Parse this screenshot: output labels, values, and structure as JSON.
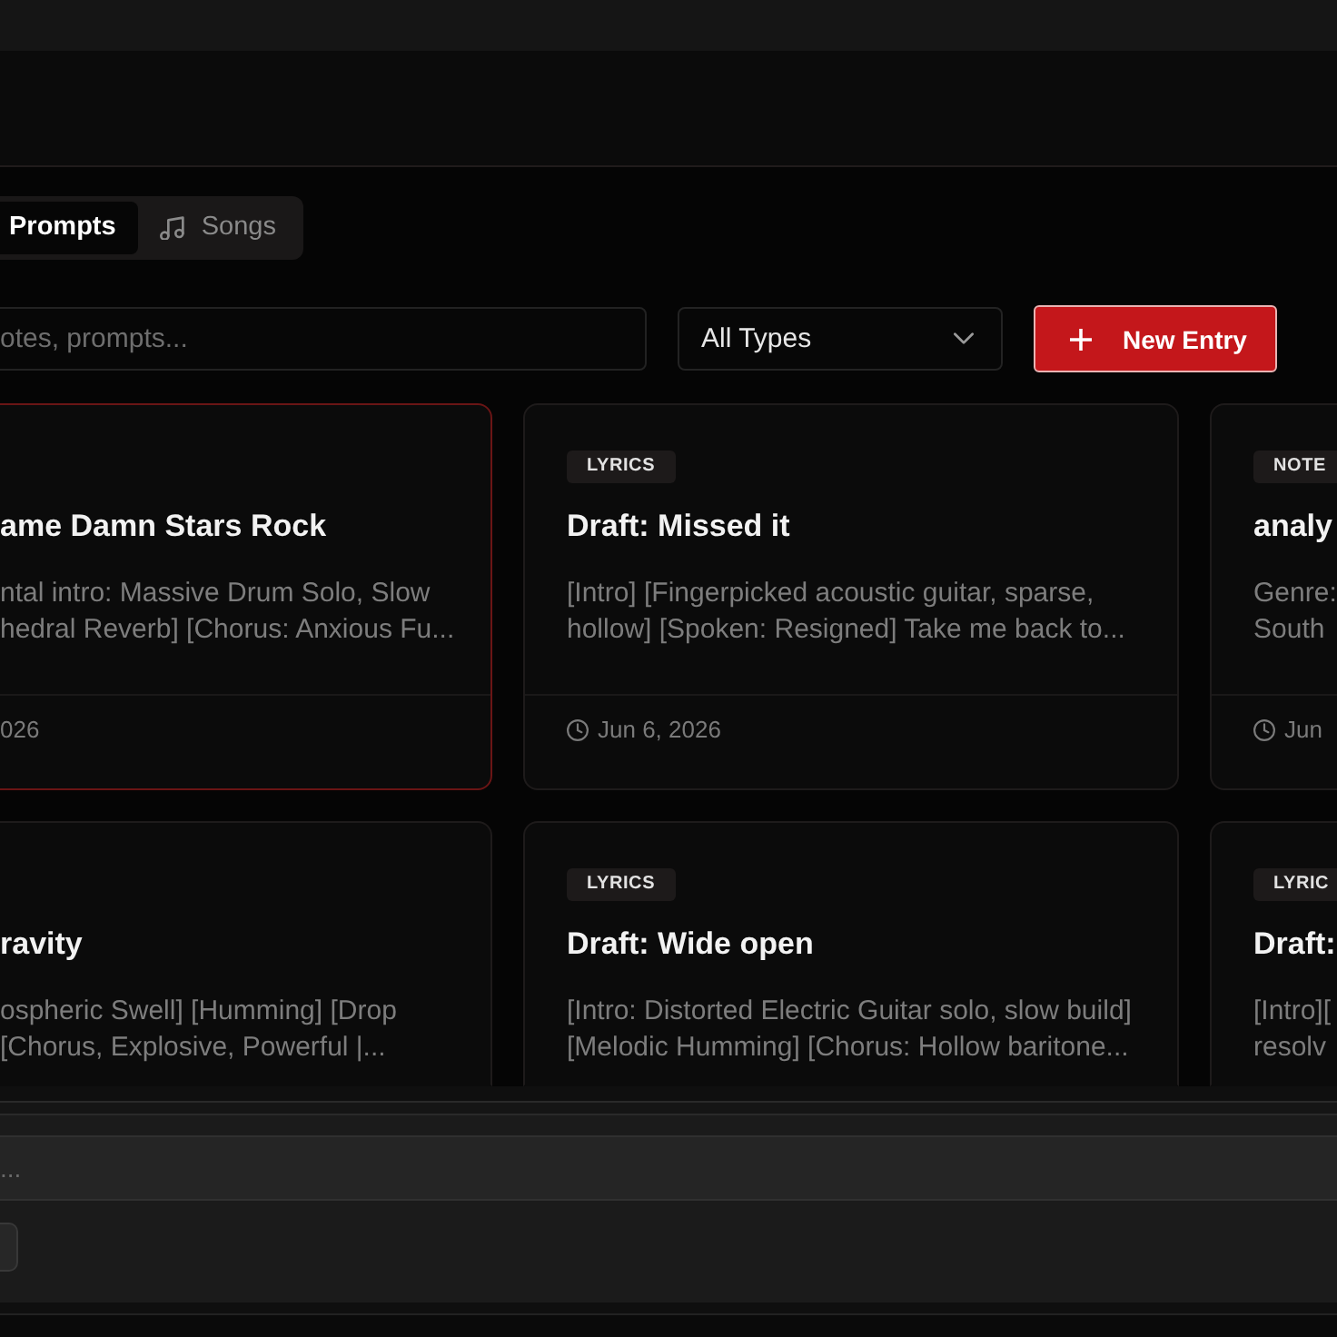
{
  "tabs": [
    {
      "label": "Prompts",
      "kind": "label-only",
      "selected": true
    },
    {
      "label": "Songs",
      "kind": "icon-label",
      "selected": false
    }
  ],
  "toolbar": {
    "search": {
      "placeholder": "otes, prompts..."
    },
    "type_filter": {
      "value": "All Types"
    },
    "new_entry_button": {
      "label": "New Entry"
    }
  },
  "cards": [
    {
      "kind": "clipped",
      "selected": true,
      "title": "ame Damn Stars Rock",
      "description_lines": [
        "ntal intro: Massive Drum Solo, Slow",
        "hedral Reverb] [Chorus: Anxious Fu..."
      ],
      "date": "026"
    },
    {
      "kind": "full",
      "selected": false,
      "badge": "LYRICS",
      "title": "Draft: Missed it",
      "description_lines": [
        "[Intro] [Fingerpicked acoustic guitar, sparse,",
        "hollow] [Spoken: Resigned] Take me back to..."
      ],
      "date": "Jun 6, 2026"
    },
    {
      "kind": "full",
      "selected": false,
      "badge": "NOTE",
      "title": "analy",
      "description_lines": [
        "Genre:",
        "South"
      ],
      "date": "Jun"
    },
    {
      "selected": false,
      "title": "ravity",
      "description_lines": [
        "ospheric Swell] [Humming] [Drop",
        "[Chorus, Explosive, Powerful |..."
      ]
    },
    {
      "selected": false,
      "badge": "LYRICS",
      "title": "Draft: Wide open",
      "description_lines": [
        "[Intro: Distorted Electric Guitar solo, slow build]",
        "[Melodic Humming] [Chorus: Hollow baritone..."
      ]
    },
    {
      "selected": false,
      "badge": "LYRIC",
      "title": "Draft:",
      "description_lines": [
        "[Intro][",
        "resolv"
      ]
    }
  ],
  "composer": {
    "placeholder": "..."
  }
}
